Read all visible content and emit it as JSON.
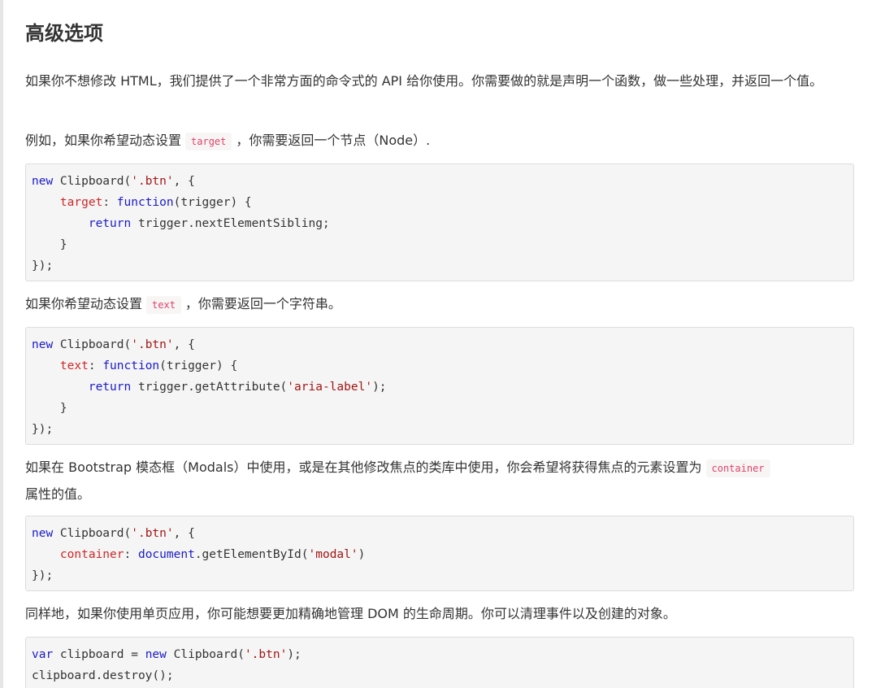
{
  "heading": "高级选项",
  "para1": "如果你不想修改 HTML，我们提供了一个非常方面的命令式的 API 给你使用。你需要做的就是声明一个函数，做一些处理，并返回一个值。",
  "para2": {
    "before": "例如，如果你希望动态设置",
    "code": "target",
    "after": "，你需要返回一个节点（Node）."
  },
  "code1": {
    "l1_new": "new",
    "l1_rest": " Clipboard(",
    "l1_str": "'.btn'",
    "l1_end": ", {",
    "l2_indent": "    ",
    "l2_prop": "target",
    "l2_colon": ": ",
    "l2_fn": "function",
    "l2_end": "(trigger) {",
    "l3_indent": "        ",
    "l3_ret": "return",
    "l3_end": " trigger.nextElementSibling;",
    "l4": "    }",
    "l5": "});"
  },
  "para3": {
    "before": "如果你希望动态设置",
    "code": "text",
    "after": "，你需要返回一个字符串。"
  },
  "code2": {
    "l1_new": "new",
    "l1_rest": " Clipboard(",
    "l1_str": "'.btn'",
    "l1_end": ", {",
    "l2_indent": "    ",
    "l2_prop": "text",
    "l2_colon": ": ",
    "l2_fn": "function",
    "l2_end": "(trigger) {",
    "l3_indent": "        ",
    "l3_ret": "return",
    "l3_mid": " trigger.getAttribute(",
    "l3_str": "'aria-label'",
    "l3_end": ");",
    "l4": "    }",
    "l5": "});"
  },
  "para4": {
    "before": "如果在 Bootstrap 模态框（Modals）中使用，或是在其他修改焦点的类库中使用，你会希望将获得焦点的元素设置为",
    "code": "container",
    "after": "属性的值。"
  },
  "code3": {
    "l1_new": "new",
    "l1_rest": " Clipboard(",
    "l1_str": "'.btn'",
    "l1_end": ", {",
    "l2_indent": "    ",
    "l2_prop": "container",
    "l2_colon": ": ",
    "l2_doc": "document",
    "l2_mid": ".getElementById(",
    "l2_str": "'modal'",
    "l2_end": ")",
    "l3": "});"
  },
  "para5": "同样地，如果你使用单页应用，你可能想要更加精确地管理 DOM 的生命周期。你可以清理事件以及创建的对象。",
  "code4": {
    "l1_var": "var",
    "l1_mid": " clipboard = ",
    "l1_new": "new",
    "l1_rest": " Clipboard(",
    "l1_str": "'.btn'",
    "l1_end": ");",
    "l2": "clipboard.destroy();"
  }
}
